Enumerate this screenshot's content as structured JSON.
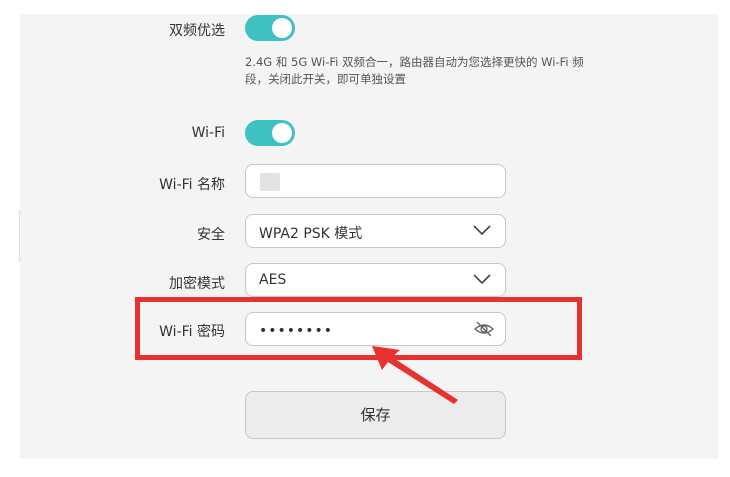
{
  "settings": {
    "dual_band": {
      "label": "双频优选",
      "enabled": true,
      "hint": "2.4G 和 5G Wi-Fi 双频合一，路由器自动为您选择更快的 Wi-Fi 频段，关闭此开关，即可单独设置"
    },
    "wifi": {
      "label": "Wi-Fi",
      "enabled": true
    },
    "wifi_name": {
      "label": "Wi-Fi 名称",
      "value": ""
    },
    "security": {
      "label": "安全",
      "value": "WPA2 PSK 模式"
    },
    "encryption": {
      "label": "加密模式",
      "value": "AES"
    },
    "wifi_password": {
      "label": "Wi-Fi 密码",
      "masked_value": "••••••••"
    },
    "save_label": "保存"
  },
  "annotation": {
    "highlight_color": "#e8322f"
  },
  "colors": {
    "toggle_on": "#3fc1c1",
    "panel_bg": "#f4f4f4"
  }
}
